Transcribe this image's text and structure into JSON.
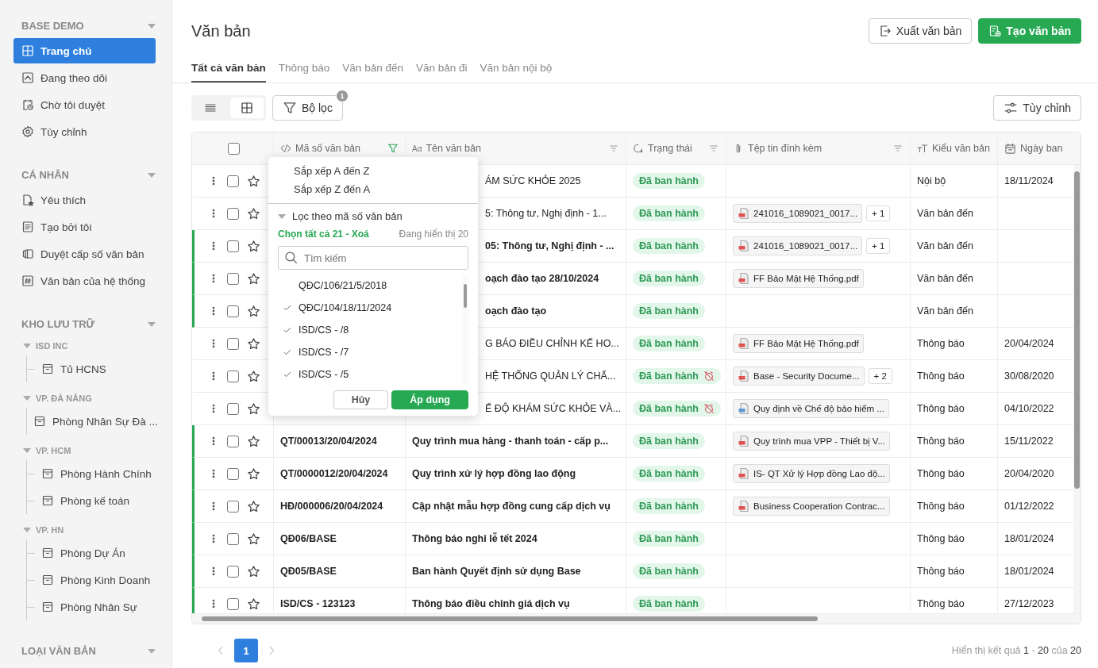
{
  "sidebar": {
    "sections": [
      {
        "title": "BASE DEMO",
        "items": [
          {
            "label": "Trang chủ",
            "selected": true
          },
          {
            "label": "Đang theo dõi",
            "selected": false
          },
          {
            "label": "Chờ tôi duyệt",
            "selected": false
          },
          {
            "label": "Tùy chỉnh",
            "selected": false
          }
        ]
      },
      {
        "title": "CÁ NHÂN",
        "items": [
          {
            "label": "Yêu thích",
            "selected": false
          },
          {
            "label": "Tạo bởi tôi",
            "selected": false
          },
          {
            "label": "Duyệt cấp số văn bản",
            "selected": false
          },
          {
            "label": "Văn bản của hệ thống",
            "selected": false
          }
        ]
      },
      {
        "title": "KHO LƯU TRỮ",
        "groups": [
          {
            "title": "ISD INC",
            "expanded": true,
            "children": [
              {
                "label": "Tủ HCNS"
              }
            ]
          },
          {
            "title": "VP. ĐÀ NẴNG",
            "expanded": true,
            "children": [
              {
                "label": "Phòng Nhân Sự Đà ..."
              }
            ]
          },
          {
            "title": "VP. HCM",
            "expanded": true,
            "children": [
              {
                "label": "Phòng Hành Chính"
              },
              {
                "label": "Phòng kế toán"
              }
            ]
          },
          {
            "title": "VP. HN",
            "expanded": true,
            "children": [
              {
                "label": "Phòng Dự Án"
              },
              {
                "label": "Phòng Kinh Doanh"
              },
              {
                "label": "Phòng Nhân Sự"
              }
            ]
          }
        ]
      },
      {
        "title": "LOẠI VĂN BẢN"
      }
    ]
  },
  "page": {
    "title": "Văn bản",
    "buttons": [
      {
        "label": "Xuất văn bản",
        "kind": "outline"
      },
      {
        "label": "Tạo văn bản",
        "kind": "primary"
      }
    ]
  },
  "tabs": [
    {
      "label": "Tất cả văn bản",
      "selected": true
    },
    {
      "label": "Thông báo",
      "selected": false
    },
    {
      "label": "Văn bản đến",
      "selected": false
    },
    {
      "label": "Văn bản đi",
      "selected": false
    },
    {
      "label": "Văn bản nội bộ",
      "selected": false
    }
  ],
  "toolbar": {
    "views": [
      {
        "kind": "list",
        "selected": false
      },
      {
        "kind": "grid",
        "selected": true
      }
    ],
    "filter_button": {
      "label": "Bộ lọc",
      "badge": "1"
    },
    "customize_button": "Tùy chỉnh"
  },
  "table": {
    "select_all_checked": false,
    "columns": [
      {
        "label": "Mã số văn bản",
        "filter_active": true
      },
      {
        "label": "Tên văn bản",
        "icon_text": "Aα",
        "filter_active": false
      },
      {
        "label": "Trạng thái",
        "filter_active": false
      },
      {
        "label": "Tệp tin đính kèm",
        "filter_active": false
      },
      {
        "label": "Kiểu văn bản"
      },
      {
        "label": "Ngày ban"
      }
    ],
    "rows": [
      {
        "marked": false,
        "name": "ÁM SỨC KHỎE 2025",
        "status": "Đã ban hành",
        "reminder_off": false,
        "type": "Nội bộ",
        "date": "18/11/2024"
      },
      {
        "marked": false,
        "name": "5: Thông tư, Nghị định - 1...",
        "status": "Đã ban hành",
        "reminder_off": false,
        "file": {
          "name": "241016_1089021_0017...",
          "kind": "pdf"
        },
        "more": "+ 1",
        "type": "Văn bản đến"
      },
      {
        "marked": true,
        "name": "05: Thông tư, Nghị định - ...",
        "status": "Đã ban hành",
        "reminder_off": false,
        "file": {
          "name": "241016_1089021_0017...",
          "kind": "pdf"
        },
        "more": "+ 1",
        "type": "Văn bản đến"
      },
      {
        "marked": true,
        "name": "oạch đào tạo 28/10/2024",
        "status": "Đã ban hành",
        "reminder_off": false,
        "file": {
          "name": "FF Bảo Mật Hệ Thống.pdf",
          "kind": "pdf"
        },
        "type": "Văn bản đến"
      },
      {
        "marked": true,
        "name": "oạch đào tạo",
        "status": "Đã ban hành",
        "reminder_off": false,
        "type": "Văn bản đến"
      },
      {
        "marked": false,
        "name": "G BÁO ĐIỀU CHỈNH KẾ HO...",
        "status": "Đã ban hành",
        "reminder_off": false,
        "file": {
          "name": "FF Bảo Mật Hệ Thống.pdf",
          "kind": "pdf"
        },
        "type": "Thông báo",
        "date": "20/04/2024"
      },
      {
        "marked": false,
        "name": "HỆ THỐNG QUẢN LÝ CHẤ...",
        "status": "Đã ban hành",
        "reminder_off": true,
        "file": {
          "name": "Base - Security Docume...",
          "kind": "pdf"
        },
        "more": "+ 2",
        "type": "Thông báo",
        "date": "30/08/2020"
      },
      {
        "marked": false,
        "name": "Ế ĐỘ KHÁM SỨC KHỎE VÀ...",
        "status": "Đã ban hành",
        "reminder_off": true,
        "file": {
          "name": "Quy định về Chế độ bảo hiểm ...",
          "kind": "doc"
        },
        "type": "Thông báo",
        "date": "04/10/2022"
      },
      {
        "marked": true,
        "code": "QT/00013/20/04/2024",
        "name": "Quy trình mua hàng - thanh toán - cấp p...",
        "status": "Đã ban hành",
        "reminder_off": false,
        "file": {
          "name": "Quy trình mua VPP - Thiết bị V...",
          "kind": "pdf"
        },
        "type": "Thông báo",
        "date": "15/11/2022"
      },
      {
        "marked": true,
        "code": "QT/0000012/20/04/2024",
        "name": "Quy trình xử lý hợp đồng lao động",
        "status": "Đã ban hành",
        "reminder_off": false,
        "file": {
          "name": "IS- QT Xử lý Hợp đồng Lao độ...",
          "kind": "pdf"
        },
        "type": "Thông báo",
        "date": "20/04/2020"
      },
      {
        "marked": true,
        "code": "HĐ/000006/20/04/2024",
        "name": "Cập nhật mẫu hợp đồng cung cấp dịch vụ",
        "status": "Đã ban hành",
        "reminder_off": false,
        "file": {
          "name": "Business Cooperation Contrac...",
          "kind": "pdf"
        },
        "type": "Thông báo",
        "date": "01/12/2022"
      },
      {
        "marked": true,
        "code": "QĐ06/BASE",
        "name": "Thông báo nghỉ lễ tết 2024",
        "status": "Đã ban hành",
        "reminder_off": false,
        "type": "Thông báo",
        "date": "18/01/2024"
      },
      {
        "marked": true,
        "code": "QĐ05/BASE",
        "name": "Ban hành Quyết định sử dụng Base",
        "status": "Đã ban hành",
        "reminder_off": false,
        "type": "Thông báo",
        "date": "18/01/2024"
      },
      {
        "marked": true,
        "code": "ISD/CS - 123123",
        "name": "Thông báo điều chỉnh giá dịch vụ",
        "status": "Đã ban hành",
        "reminder_off": false,
        "type": "Thông báo",
        "date": "27/12/2023"
      }
    ]
  },
  "filter_popup": {
    "sort_options": [
      "Sắp xếp A đến Z",
      "Sắp xếp Z đến A"
    ],
    "section_title": "Lọc theo mã số văn bản",
    "select_all": "Chọn tất cả 21",
    "separator": "-",
    "clear": "Xoá",
    "shown_count": "Đang hiển thị 20",
    "search": {
      "placeholder": "Tìm kiếm"
    },
    "options": [
      {
        "label": "QĐC/106/21/5/2018",
        "checked": false
      },
      {
        "label": "QĐC/104/18/11/2024",
        "checked": true
      },
      {
        "label": "ISD/CS - /8",
        "checked": true
      },
      {
        "label": "ISD/CS - /7",
        "checked": true
      },
      {
        "label": "ISD/CS - /5",
        "checked": true
      }
    ],
    "buttons": [
      {
        "label": "Hủy",
        "kind": "outline"
      },
      {
        "label": "Áp dụng",
        "kind": "primary"
      }
    ]
  },
  "pagination": {
    "pages": [
      {
        "label": "1",
        "selected": true
      }
    ],
    "summary": "Hiển thị kết quả **1** - **20** của **20**"
  }
}
